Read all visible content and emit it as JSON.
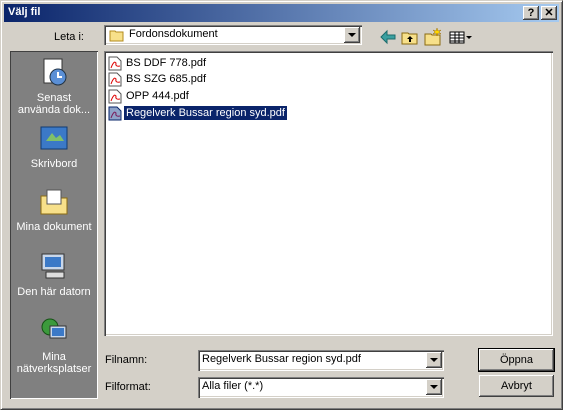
{
  "window": {
    "title": "Välj fil"
  },
  "titlebar": {
    "help_label": "?",
    "close_label": "✕"
  },
  "toolbar": {
    "look_in_label": "Leta i:",
    "look_in_value": "Fordonsdokument",
    "back_icon": "back-arrow-icon",
    "up_icon": "up-folder-icon",
    "new_folder_icon": "new-folder-icon",
    "view_icon": "view-menu-icon"
  },
  "places": [
    {
      "label_line1": "Senast",
      "label_line2": "använda dok...",
      "icon": "recent-documents-icon"
    },
    {
      "label_line1": "Skrivbord",
      "label_line2": "",
      "icon": "desktop-icon"
    },
    {
      "label_line1": "Mina dokument",
      "label_line2": "",
      "icon": "my-documents-icon"
    },
    {
      "label_line1": "Den här datorn",
      "label_line2": "",
      "icon": "my-computer-icon"
    },
    {
      "label_line1": "Mina",
      "label_line2": "nätverksplatser",
      "icon": "network-places-icon"
    }
  ],
  "files": [
    {
      "name": "BS DDF 778.pdf"
    },
    {
      "name": "BS SZG 685.pdf"
    },
    {
      "name": "OPP 444.pdf"
    },
    {
      "name": "Regelverk Bussar region syd.pdf",
      "selected": true
    }
  ],
  "filename": {
    "label": "Filnamn:",
    "value": "Regelverk Bussar region syd.pdf"
  },
  "filetype": {
    "label": "Filformat:",
    "value": "Alla filer (*.*)"
  },
  "buttons": {
    "open": "Öppna",
    "cancel": "Avbryt"
  },
  "colors": {
    "titlebar_start": "#0a246a",
    "titlebar_end": "#a6caf0",
    "selection": "#0a246a",
    "face": "#d4d0c8"
  }
}
